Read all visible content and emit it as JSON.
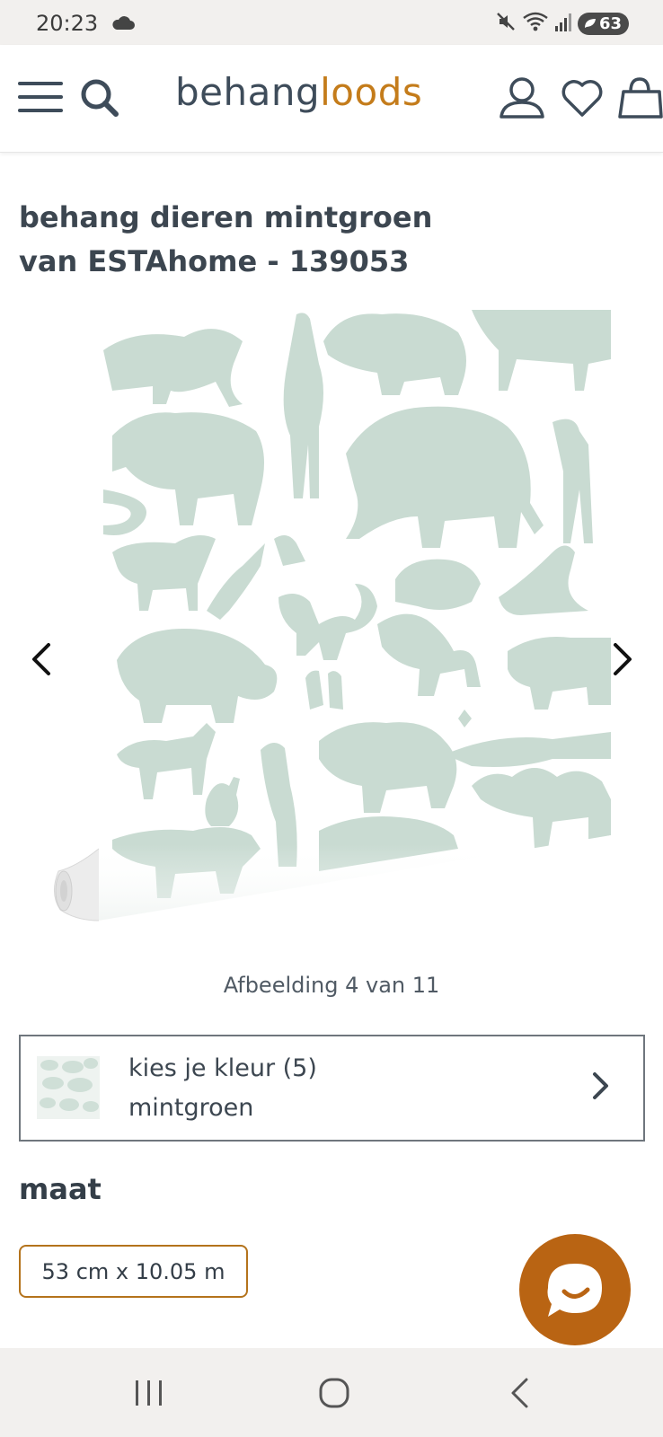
{
  "status_bar": {
    "time": "20:23",
    "battery": "63",
    "icons": [
      "cloud-icon",
      "mute-icon",
      "wifi-icon",
      "signal-icon",
      "battery-icon"
    ]
  },
  "header": {
    "logo_part1": "behang",
    "logo_part2": "loods",
    "icons": [
      "menu-icon",
      "search-icon",
      "account-icon",
      "wishlist-heart-icon",
      "cart-bag-icon"
    ]
  },
  "product": {
    "title_line1": "behang dieren mintgroen",
    "title_line2": "van ESTAhome - 139053",
    "image_counter": "Afbeelding 4 van 11"
  },
  "color_selector": {
    "label": "kies je kleur (5)",
    "value": "mintgroen"
  },
  "size": {
    "label": "maat",
    "option": "53 cm x 10.05 m"
  },
  "colors": {
    "brand_dark": "#3e4c5a",
    "brand_accent": "#c47c1b",
    "chat_button": "#b96413",
    "wallpaper_mint": "#c9dbd2"
  }
}
